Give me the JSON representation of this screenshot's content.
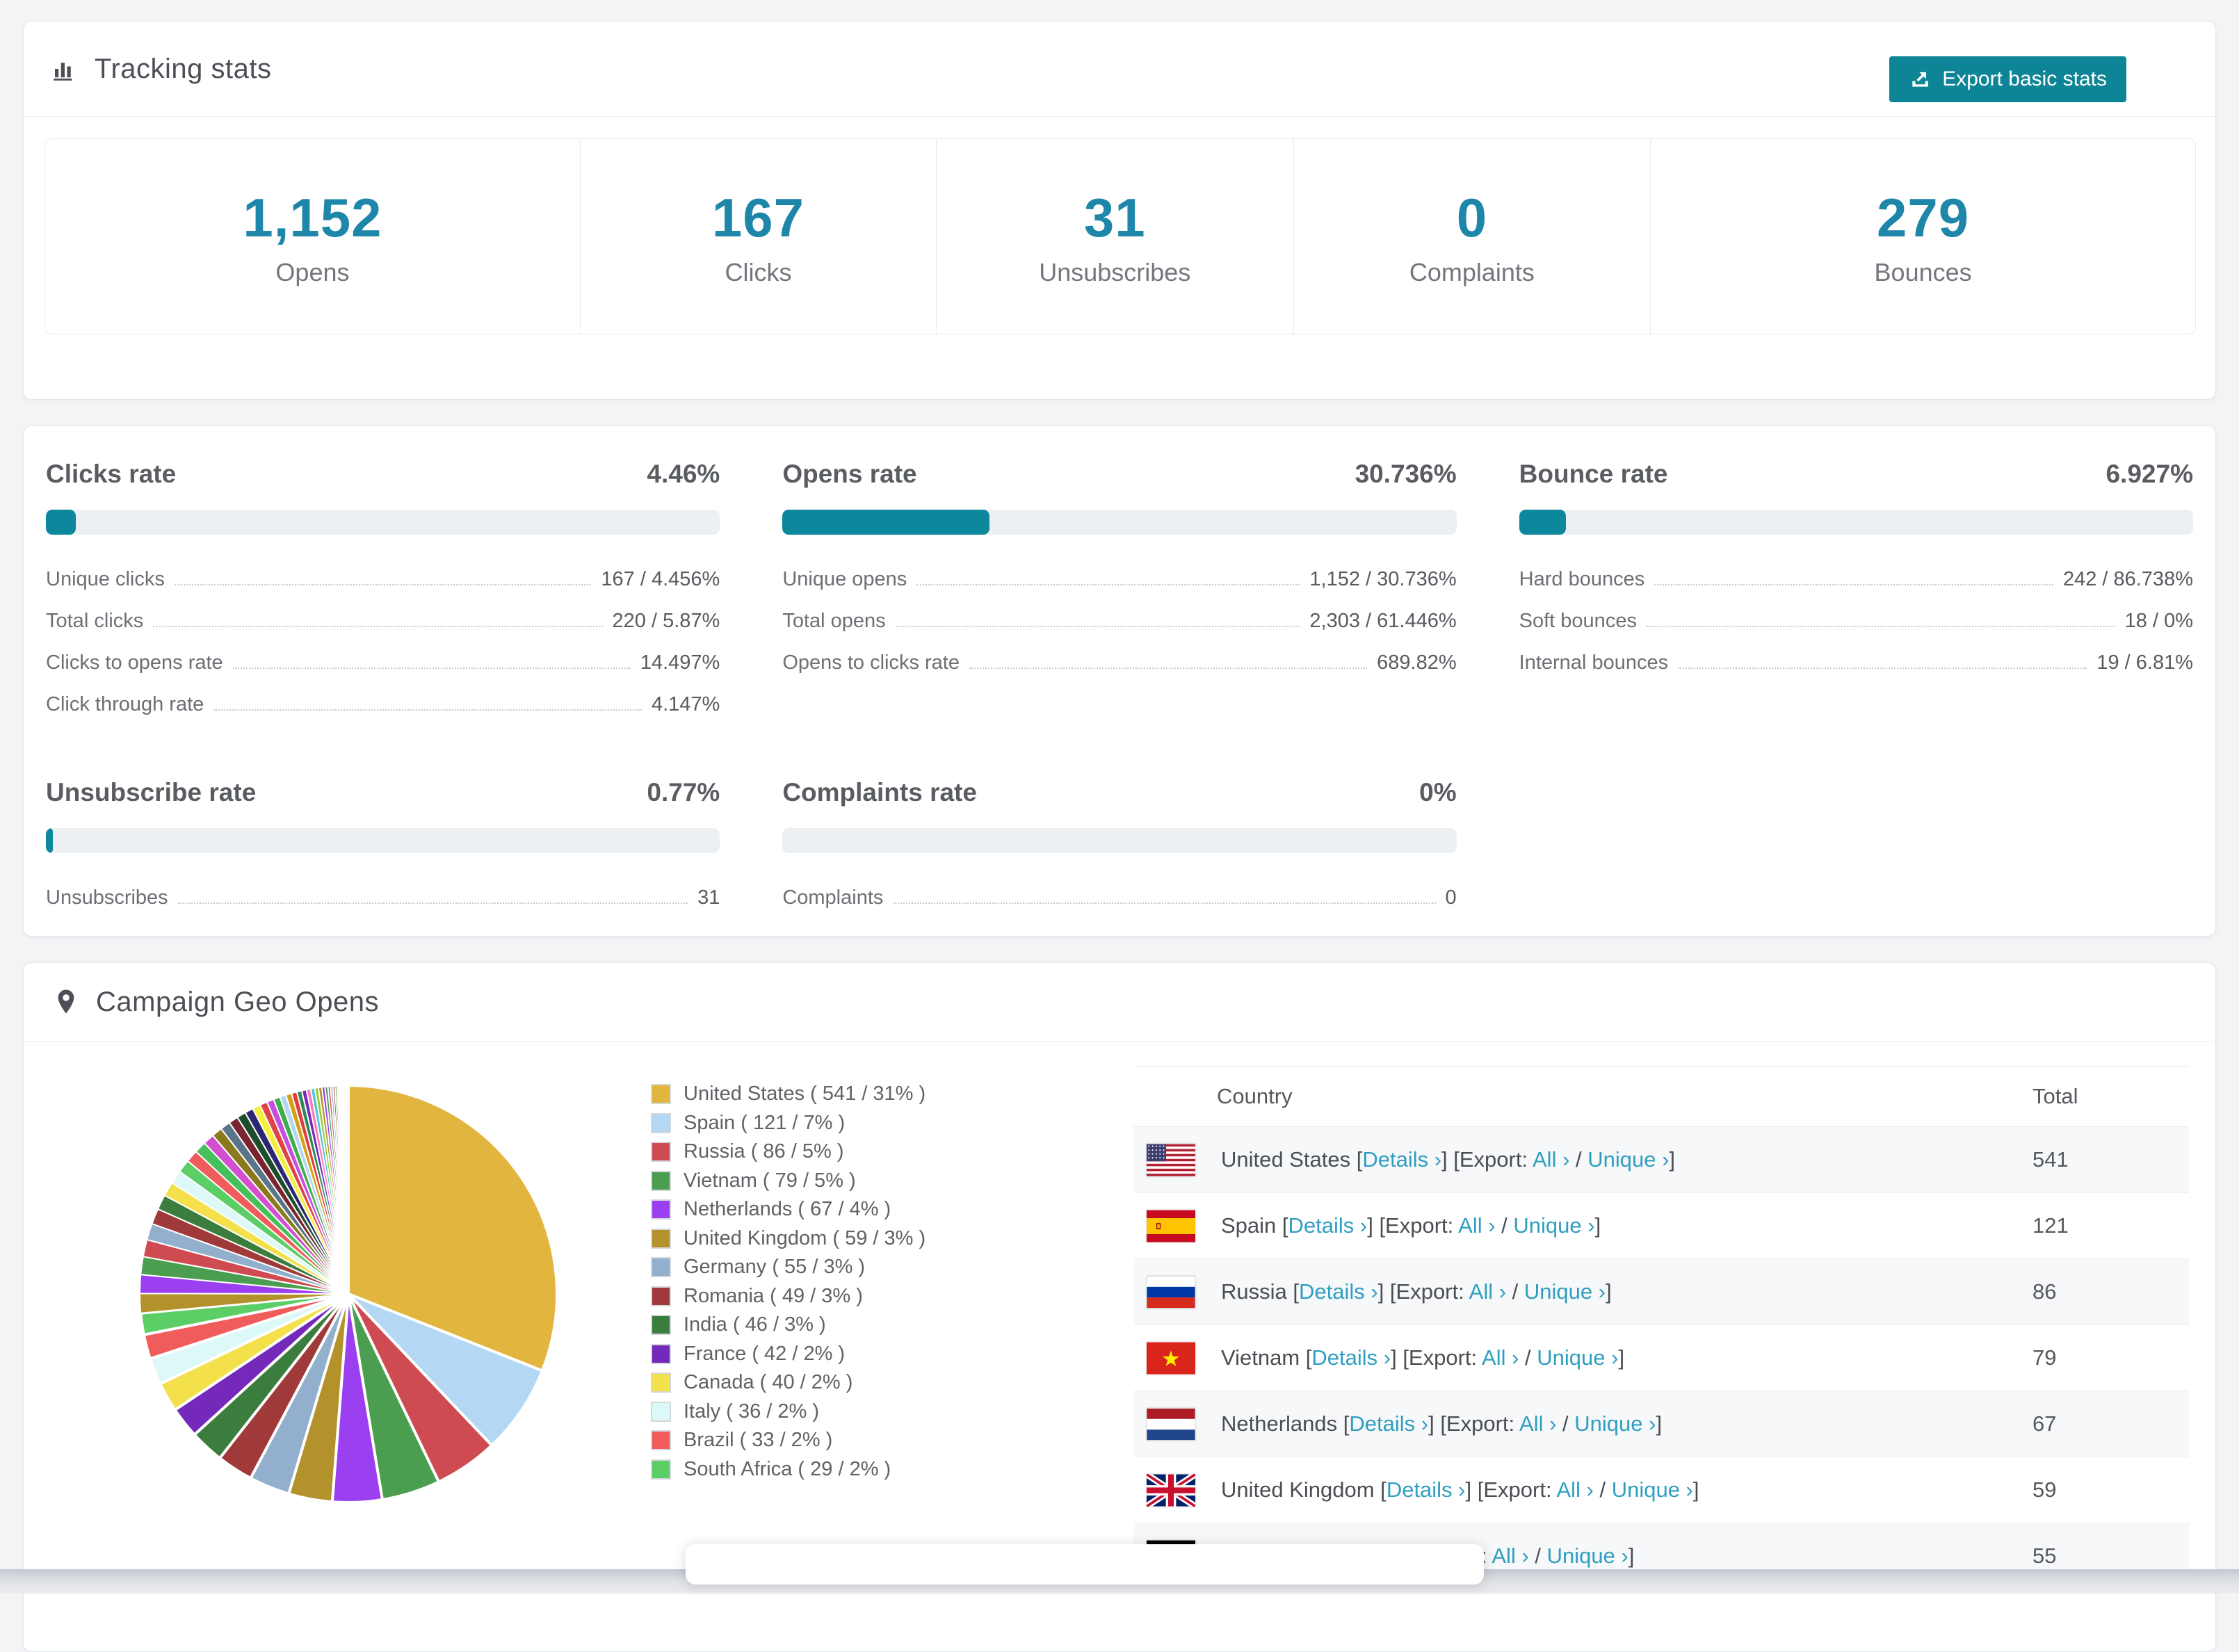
{
  "colors": {
    "accent_teal": "#0e8596",
    "stat_number_teal": "#1e87a9",
    "bar_fill_teal": "#0c879b",
    "link_teal": "#2f9fc0"
  },
  "header": {
    "title": "Tracking stats",
    "export_button": "Export basic stats"
  },
  "summary_stats": [
    {
      "value": "1,152",
      "label": "Opens"
    },
    {
      "value": "167",
      "label": "Clicks"
    },
    {
      "value": "31",
      "label": "Unsubscribes"
    },
    {
      "value": "0",
      "label": "Complaints"
    },
    {
      "value": "279",
      "label": "Bounces"
    }
  ],
  "rate_blocks": [
    {
      "id": "clicks-rate",
      "title": "Clicks rate",
      "value": "4.46%",
      "bar_percent": 4.46,
      "rows": [
        {
          "label": "Unique clicks",
          "value": "167 / 4.456%"
        },
        {
          "label": "Total clicks",
          "value": "220 / 5.87%"
        },
        {
          "label": "Clicks to opens rate",
          "value": "14.497%"
        },
        {
          "label": "Click through rate",
          "value": "4.147%"
        }
      ]
    },
    {
      "id": "opens-rate",
      "title": "Opens rate",
      "value": "30.736%",
      "bar_percent": 30.736,
      "rows": [
        {
          "label": "Unique opens",
          "value": "1,152 / 30.736%"
        },
        {
          "label": "Total opens",
          "value": "2,303 / 61.446%"
        },
        {
          "label": "Opens to clicks rate",
          "value": "689.82%"
        }
      ]
    },
    {
      "id": "bounce-rate",
      "title": "Bounce rate",
      "value": "6.927%",
      "bar_percent": 6.927,
      "rows": [
        {
          "label": "Hard bounces",
          "value": "242 / 86.738%"
        },
        {
          "label": "Soft bounces",
          "value": "18 / 0%"
        },
        {
          "label": "Internal bounces",
          "value": "19 / 6.81%"
        }
      ]
    },
    {
      "id": "unsubscribe-rate",
      "title": "Unsubscribe rate",
      "value": "0.77%",
      "bar_percent": 0.77,
      "rows": [
        {
          "label": "Unsubscribes",
          "value": "31"
        }
      ]
    },
    {
      "id": "complaints-rate",
      "title": "Complaints rate",
      "value": "0%",
      "bar_percent": 0,
      "rows": [
        {
          "label": "Complaints",
          "value": "0"
        }
      ]
    }
  ],
  "geo": {
    "title": "Campaign Geo Opens",
    "table": {
      "columns": [
        "Country",
        "Total"
      ],
      "details_label": "Details ›",
      "export_prefix": "Export:",
      "all_label": "All ›",
      "unique_label": "Unique ›",
      "rows": [
        {
          "country": "United States",
          "code": "us",
          "total": "541"
        },
        {
          "country": "Spain",
          "code": "es",
          "total": "121"
        },
        {
          "country": "Russia",
          "code": "ru",
          "total": "86"
        },
        {
          "country": "Vietnam",
          "code": "vn",
          "total": "79"
        },
        {
          "country": "Netherlands",
          "code": "nl",
          "total": "67"
        },
        {
          "country": "United Kingdom",
          "code": "gb",
          "total": "59"
        },
        {
          "country": "Germany",
          "code": "de",
          "total": "55"
        }
      ]
    }
  },
  "chart_data": {
    "type": "pie",
    "title": "Campaign Geo Opens",
    "legend_position": "right",
    "start_angle_deg": 0,
    "direction": "clockwise",
    "labels": [
      "United States",
      "Spain",
      "Russia",
      "Vietnam",
      "Netherlands",
      "United Kingdom",
      "Germany",
      "Romania",
      "India",
      "France",
      "Canada",
      "Italy",
      "Brazil",
      "South Africa"
    ],
    "values": [
      541,
      121,
      86,
      79,
      67,
      59,
      55,
      49,
      46,
      42,
      40,
      36,
      33,
      29
    ],
    "percents": [
      31,
      7,
      5,
      5,
      4,
      3,
      3,
      3,
      3,
      2,
      2,
      2,
      2,
      2
    ],
    "colors": [
      "#e2b63e",
      "#b4d8f3",
      "#ce4c51",
      "#4b9e50",
      "#9b40f0",
      "#b3912b",
      "#92afcd",
      "#a03a3a",
      "#3a7d3c",
      "#7429bb",
      "#f4e04a",
      "#dcf9f7",
      "#f05c5c",
      "#5bce66"
    ],
    "others_total": 462,
    "others_palette": [
      "#b3912b",
      "#9b40f0",
      "#4b9e50",
      "#ce4c51",
      "#92afcd",
      "#a03a3a",
      "#3a7d3c",
      "#f4e04a",
      "#dcf9f7",
      "#5bce66",
      "#f05c5c",
      "#45c05a",
      "#d44fd0",
      "#8a7a1e",
      "#5a7587",
      "#7a2430",
      "#1e4d2b",
      "#2b2870",
      "#f3ef3a",
      "#e04343",
      "#c44fe0",
      "#3fae4c",
      "#b4d8f3",
      "#d4a017",
      "#e23b3b",
      "#2e8b57",
      "#7429bb",
      "#ff7ab8",
      "#49c8d8",
      "#9acd32"
    ]
  }
}
